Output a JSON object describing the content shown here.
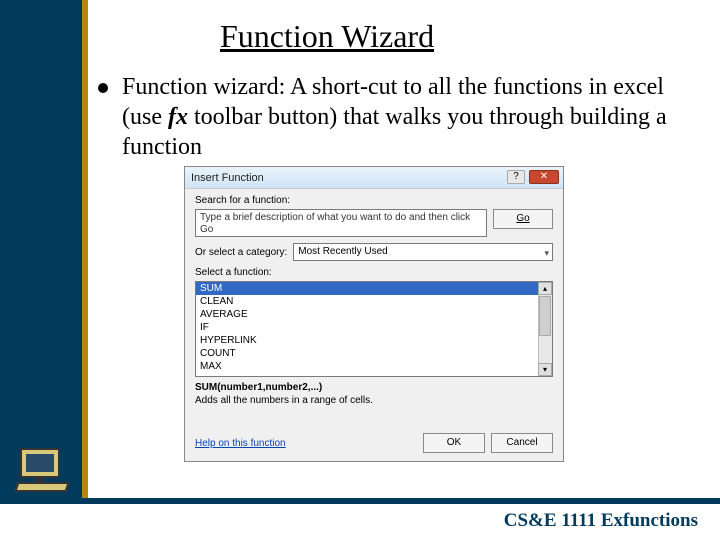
{
  "slide": {
    "title": "Function Wizard",
    "bullet_pre": "Function wizard: A short-cut to all the functions in excel (use ",
    "bullet_fx": "fx",
    "bullet_post": " toolbar button) that walks you through building a function",
    "footer": "CS&E 1111  Exfunctions"
  },
  "dialog": {
    "title": "Insert Function",
    "help_btn": "?",
    "close_btn": "✕",
    "search_label": "Search for a function:",
    "search_value": "Type a brief description of what you want to do and then click Go",
    "go_label": "Go",
    "category_label": "Or select a category:",
    "category_value": "Most Recently Used",
    "select_label": "Select a function:",
    "functions": [
      "SUM",
      "CLEAN",
      "AVERAGE",
      "IF",
      "HYPERLINK",
      "COUNT",
      "MAX"
    ],
    "signature": "SUM(number1,number2,...)",
    "description": "Adds all the numbers in a range of cells.",
    "help_link": "Help on this function",
    "ok": "OK",
    "cancel": "Cancel"
  }
}
